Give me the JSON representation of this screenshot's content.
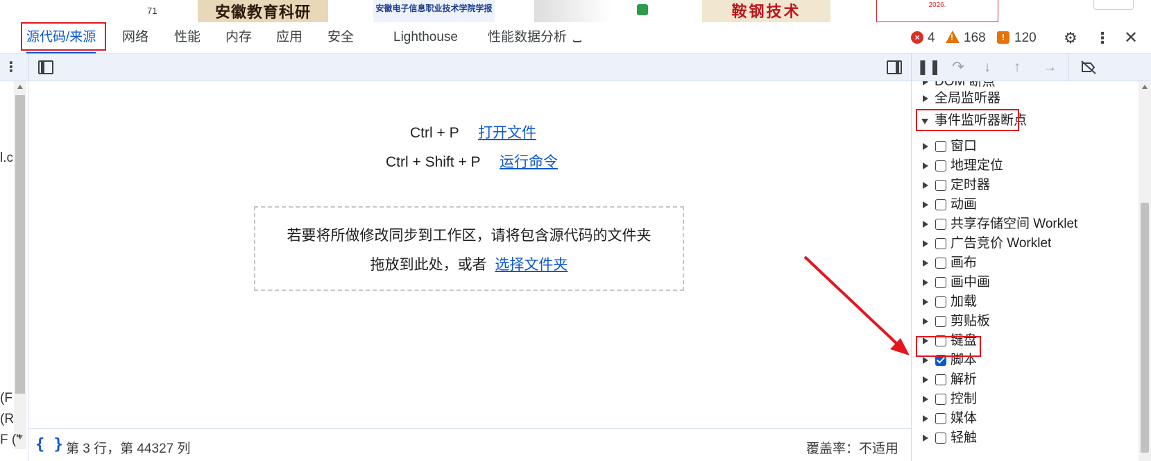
{
  "page_strip": {
    "number": "71",
    "tiles": [
      "安徽教育科研",
      "安徽电子信息职业技术学院学报",
      "",
      "鞍钢技术",
      "2026."
    ]
  },
  "tabs": [
    {
      "label": "源代码/来源",
      "active": true
    },
    {
      "label": "网络"
    },
    {
      "label": "性能"
    },
    {
      "label": "内存"
    },
    {
      "label": "应用"
    },
    {
      "label": "安全"
    },
    {
      "label": "Lighthouse"
    },
    {
      "label": "性能数据分析"
    }
  ],
  "counters": {
    "errors": "4",
    "warnings": "168",
    "issues": "120"
  },
  "left_rail": {
    "snippets": [
      "l.c",
      "(F",
      "(R",
      "F (\""
    ]
  },
  "editor": {
    "shortcut_open_keys": "Ctrl + P",
    "shortcut_open_label": "打开文件",
    "shortcut_cmd_keys": "Ctrl + Shift + P",
    "shortcut_cmd_label": "运行命令",
    "drop_line1": "若要将所做修改同步到工作区，请将包含源代码的文件夹",
    "drop_line2_prefix": "拖放到此处，或者",
    "drop_line2_link": "选择文件夹"
  },
  "status": {
    "position": "第 3 行，第 44327 列",
    "coverage": "覆盖率：不适用"
  },
  "breakpoints": {
    "partial_header": "DOM 断点",
    "global_listeners": "全局监听器",
    "event_listener_header": "事件监听器断点",
    "items": [
      {
        "label": "窗口",
        "checked": false
      },
      {
        "label": "地理定位",
        "checked": false
      },
      {
        "label": "定时器",
        "checked": false
      },
      {
        "label": "动画",
        "checked": false
      },
      {
        "label": "共享存储空间 Worklet",
        "checked": false
      },
      {
        "label": "广告竞价 Worklet",
        "checked": false
      },
      {
        "label": "画布",
        "checked": false
      },
      {
        "label": "画中画",
        "checked": false
      },
      {
        "label": "加载",
        "checked": false
      },
      {
        "label": "剪贴板",
        "checked": false
      },
      {
        "label": "键盘",
        "checked": false
      },
      {
        "label": "脚本",
        "checked": true
      },
      {
        "label": "解析",
        "checked": false
      },
      {
        "label": "控制",
        "checked": false
      },
      {
        "label": "媒体",
        "checked": false
      },
      {
        "label": "轻触",
        "checked": false
      }
    ]
  },
  "colors": {
    "accent": "#0b57d0",
    "annotation": "#e4161f"
  }
}
